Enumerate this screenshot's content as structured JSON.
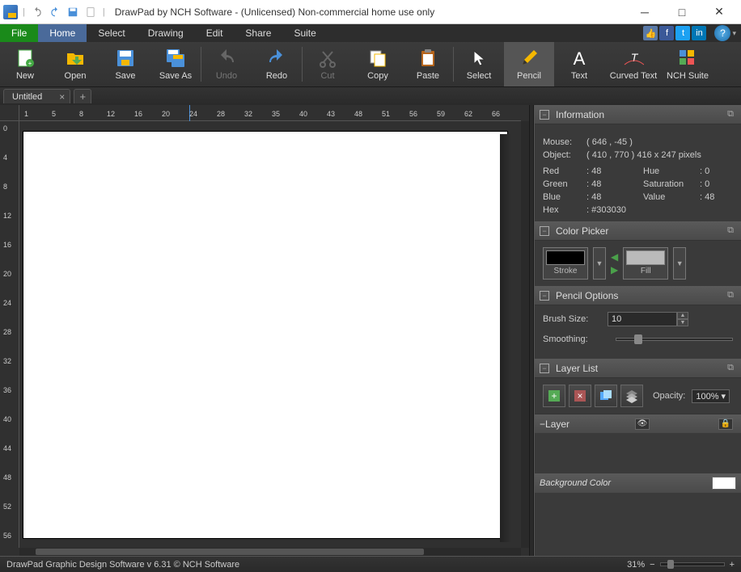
{
  "titlebar": {
    "title": "DrawPad by NCH Software - (Unlicensed) Non-commercial home use only"
  },
  "menu": {
    "file": "File",
    "home": "Home",
    "select": "Select",
    "drawing": "Drawing",
    "edit": "Edit",
    "share": "Share",
    "suite": "Suite"
  },
  "ribbon": {
    "new": "New",
    "open": "Open",
    "save": "Save",
    "saveas": "Save As",
    "undo": "Undo",
    "redo": "Redo",
    "cut": "Cut",
    "copy": "Copy",
    "paste": "Paste",
    "select": "Select",
    "pencil": "Pencil",
    "text": "Text",
    "curvedtext": "Curved Text",
    "nchsuite": "NCH Suite"
  },
  "tabs": {
    "doc1": "Untitled"
  },
  "panels": {
    "information": {
      "title": "Information",
      "mouse_lbl": "Mouse:",
      "mouse_val": "( 646 , -45 )",
      "object_lbl": "Object:",
      "object_val": "( 410 , 770 ) 416 x 247 pixels",
      "red_lbl": "Red",
      "red_val": ": 48",
      "green_lbl": "Green",
      "green_val": ": 48",
      "blue_lbl": "Blue",
      "blue_val": ": 48",
      "hue_lbl": "Hue",
      "hue_val": ": 0",
      "sat_lbl": "Saturation",
      "sat_val": ": 0",
      "val_lbl": "Value",
      "val_val": ": 48",
      "hex_lbl": "Hex",
      "hex_val": ": #303030"
    },
    "colorpicker": {
      "title": "Color Picker",
      "stroke": "Stroke",
      "fill": "Fill",
      "stroke_color": "#000000",
      "fill_color": "#bababa"
    },
    "penciloptions": {
      "title": "Pencil Options",
      "brushsize_lbl": "Brush Size:",
      "brushsize_val": "10",
      "smoothing_lbl": "Smoothing:"
    },
    "layerlist": {
      "title": "Layer List",
      "opacity_lbl": "Opacity:",
      "opacity_val": "100%"
    },
    "layer": {
      "title": "Layer",
      "bg_label": "Background Color"
    }
  },
  "ruler_h": [
    "1",
    "5",
    "8",
    "12",
    "16",
    "20",
    "24",
    "28",
    "32",
    "35",
    "40",
    "43",
    "48",
    "51",
    "56",
    "59",
    "62",
    "66"
  ],
  "ruler_v": [
    "0",
    "4",
    "8",
    "12",
    "16",
    "20",
    "24",
    "28",
    "32",
    "36",
    "40",
    "44",
    "48",
    "52",
    "56"
  ],
  "statusbar": {
    "left": "DrawPad Graphic Design Software v 6.31 © NCH Software",
    "zoom": "31%"
  }
}
